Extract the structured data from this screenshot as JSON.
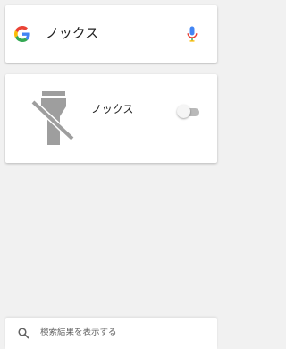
{
  "search_box": {
    "query": "ノックス",
    "logo_icon": "google-g-icon",
    "mic_icon": "microphone-icon"
  },
  "result": {
    "title": "ノックス",
    "icon": "flashlight-off-icon",
    "toggle_on": false
  },
  "bottom_bar": {
    "label": "検索結果を表示する",
    "icon": "search-icon"
  },
  "colors": {
    "background": "#f1f1f1",
    "card": "#ffffff",
    "icon_gray": "#9e9e9e",
    "google_blue": "#4285F4",
    "google_red": "#EA4335",
    "google_yellow": "#FBBC05",
    "google_green": "#34A853"
  }
}
